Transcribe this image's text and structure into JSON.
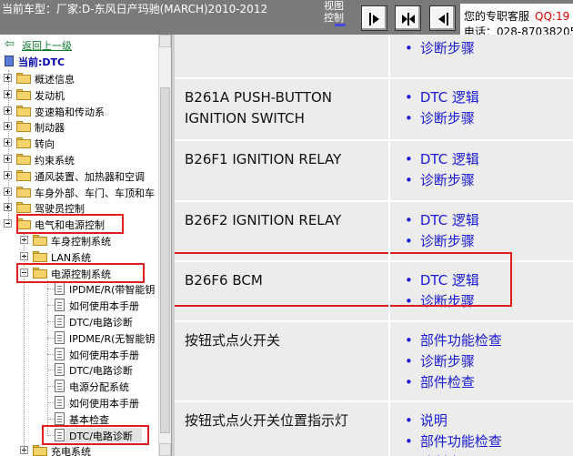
{
  "topbar": {
    "vehicle_label": "当前车型：厂家:D-东风日产玛驰(MARCH)2010-2012",
    "view_control": "视图控制",
    "buttons": [
      {
        "name": "show-left-pane",
        "icon": "arrow-right-to-bar-icon"
      },
      {
        "name": "show-both-panes",
        "icon": "arrows-outward-icon"
      },
      {
        "name": "hide-left-pane",
        "icon": "arrow-left-to-bar-icon"
      }
    ],
    "support_label": "您的专职客服",
    "support_qq": "QQ:19",
    "support_phone": "电话：028-87038205"
  },
  "tree": {
    "back_label": "返回上一级",
    "current_label": "当前:DTC",
    "items": [
      {
        "label": "概述信息",
        "level": 0,
        "type": "folder",
        "expanded": false
      },
      {
        "label": "发动机",
        "level": 0,
        "type": "folder",
        "expanded": false
      },
      {
        "label": "变速箱和传动系",
        "level": 0,
        "type": "folder",
        "expanded": false
      },
      {
        "label": "制动器",
        "level": 0,
        "type": "folder",
        "expanded": false
      },
      {
        "label": "转向",
        "level": 0,
        "type": "folder",
        "expanded": false
      },
      {
        "label": "约束系统",
        "level": 0,
        "type": "folder",
        "expanded": false
      },
      {
        "label": "通风装置、加热器和空调",
        "level": 0,
        "type": "folder",
        "expanded": false
      },
      {
        "label": "车身外部、车门、车顶和车",
        "level": 0,
        "type": "folder",
        "expanded": false
      },
      {
        "label": "驾驶员控制",
        "level": 0,
        "type": "folder",
        "expanded": false
      },
      {
        "label": "电气和电源控制",
        "level": 0,
        "type": "folder",
        "expanded": true,
        "highlighted": true
      },
      {
        "label": "车身控制系统",
        "level": 1,
        "type": "folder",
        "expanded": false
      },
      {
        "label": "LAN系统",
        "level": 1,
        "type": "folder",
        "expanded": false
      },
      {
        "label": "电源控制系统",
        "level": 1,
        "type": "folder",
        "expanded": true,
        "highlighted": true
      },
      {
        "label": "IPDME/R(带智能钥",
        "level": 2,
        "type": "doc"
      },
      {
        "label": "如何使用本手册",
        "level": 2,
        "type": "doc"
      },
      {
        "label": "DTC/电路诊断",
        "level": 2,
        "type": "doc"
      },
      {
        "label": "IPDME/R(无智能钥",
        "level": 2,
        "type": "doc"
      },
      {
        "label": "如何使用本手册",
        "level": 2,
        "type": "doc"
      },
      {
        "label": "DTC/电路诊断",
        "level": 2,
        "type": "doc"
      },
      {
        "label": "电源分配系统",
        "level": 2,
        "type": "doc"
      },
      {
        "label": "如何使用本手册",
        "level": 2,
        "type": "doc"
      },
      {
        "label": "基本检查",
        "level": 2,
        "type": "doc"
      },
      {
        "label": "DTC/电路诊断",
        "level": 2,
        "type": "doc",
        "highlighted": true,
        "selected": true
      },
      {
        "label": "充电系统",
        "level": 1,
        "type": "folder",
        "expanded": false
      }
    ]
  },
  "content": {
    "rows": [
      {
        "title": "",
        "links": [
          "诊断步骤"
        ]
      },
      {
        "title": "B261A PUSH-BUTTON IGNITION SWITCH",
        "links": [
          "DTC 逻辑",
          "诊断步骤"
        ]
      },
      {
        "title": "B26F1 IGNITION RELAY",
        "links": [
          "DTC 逻辑",
          "诊断步骤"
        ]
      },
      {
        "title": "B26F2 IGNITION RELAY",
        "links": [
          "DTC 逻辑",
          "诊断步骤"
        ]
      },
      {
        "title": "B26F6 BCM",
        "links": [
          "DTC 逻辑",
          "诊断步骤"
        ],
        "highlighted": true
      },
      {
        "title": "按钮式点火开关",
        "links": [
          "部件功能检查",
          "诊断步骤",
          "部件检查"
        ]
      },
      {
        "title": "按钮式点火开关位置指示灯",
        "links": [
          "说明",
          "部件功能检查",
          "诊断步骤"
        ]
      }
    ]
  },
  "colors": {
    "topbar_bg": "#7a7a7a",
    "highlight": "#e11d1d",
    "link": "#1a1adc",
    "back_link": "#0a7b2b",
    "content_bg": "#ececec"
  }
}
